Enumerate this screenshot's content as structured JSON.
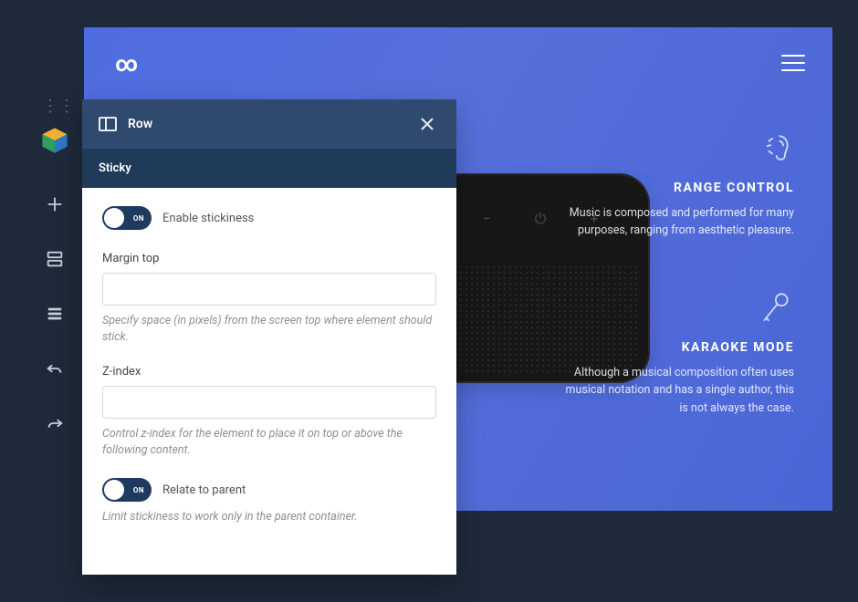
{
  "preview": {
    "logo_glyph": "∞",
    "features": [
      {
        "title": "RANGE CONTROL",
        "desc": "Music is composed and performed for many purposes, ranging from aesthetic pleasure."
      },
      {
        "title": "KARAOKE MODE",
        "desc": "Although a musical composition often uses musical notation and has a single author, this is not always the case."
      }
    ]
  },
  "panel": {
    "header_title": "Row",
    "section_title": "Sticky",
    "toggle_small_label": "ON",
    "enable_stickiness_label": "Enable stickiness",
    "margin_top": {
      "label": "Margin top",
      "value": "",
      "hint": "Specify space (in pixels) from the screen top where element should stick."
    },
    "zindex": {
      "label": "Z-index",
      "value": "",
      "hint": "Control z-index for the element to place it on top or above the following content."
    },
    "relate_parent_label": "Relate to parent",
    "relate_parent_hint": "Limit stickiness to work only in the parent container."
  }
}
